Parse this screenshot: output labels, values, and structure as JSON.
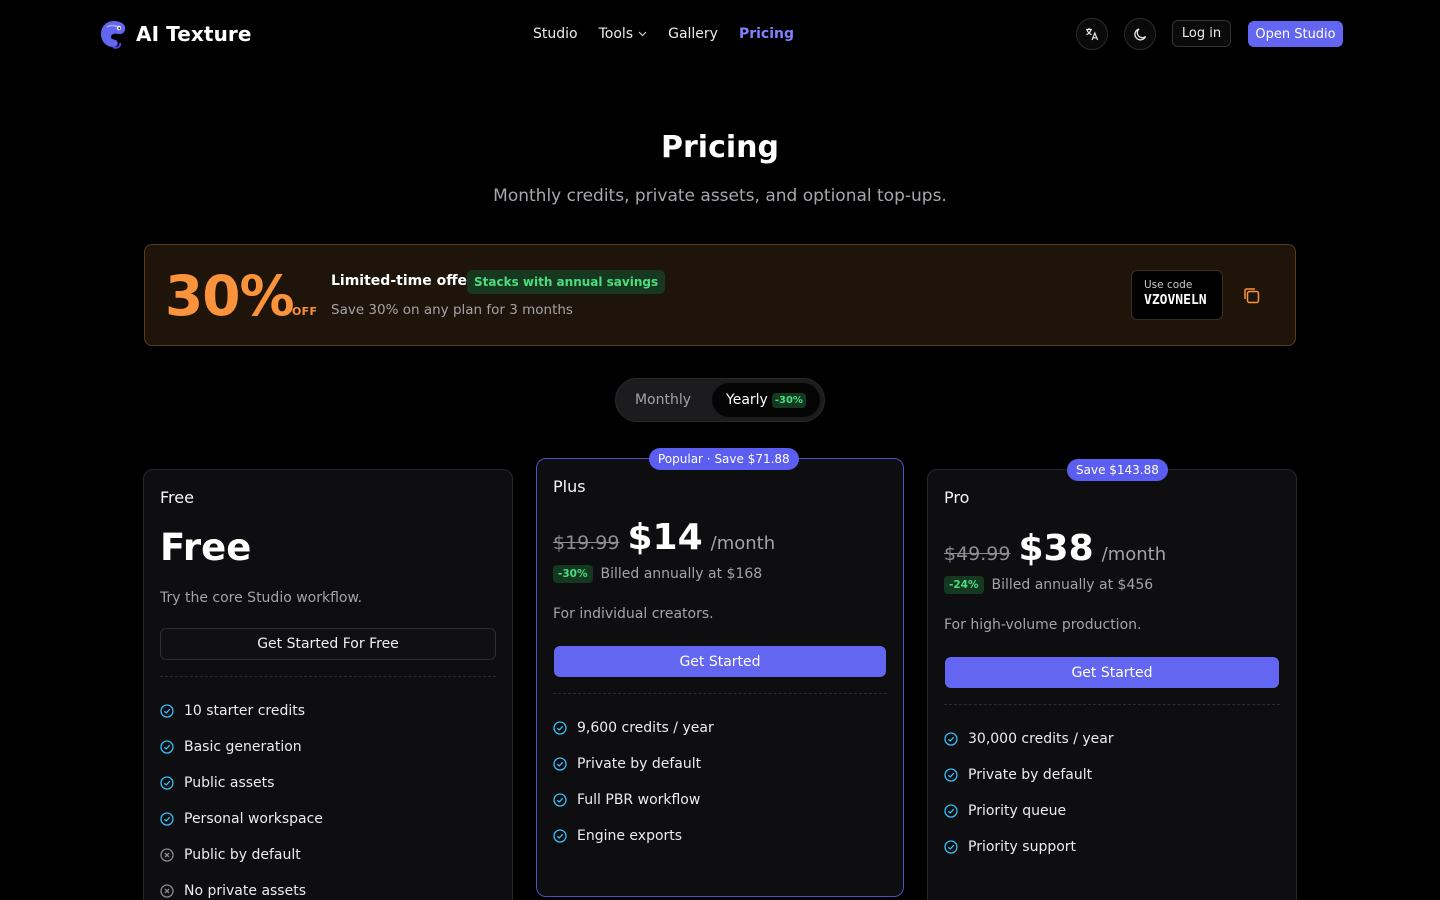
{
  "header": {
    "brand": "AI Texture",
    "nav": [
      {
        "label": "Studio"
      },
      {
        "label": "Tools"
      },
      {
        "label": "Gallery"
      },
      {
        "label": "Pricing"
      }
    ],
    "login_label": "Log in",
    "open_studio_label": "Open Studio"
  },
  "hero": {
    "title": "Pricing",
    "subtitle": "Monthly credits, private assets, and optional top-ups."
  },
  "offer": {
    "percent": "30%",
    "off": "OFF",
    "title": "Limited-time offer",
    "tag": "Stacks with annual savings",
    "description": "Save 30% on any plan for 3 months",
    "code_label": "Use code",
    "code": "VZOVNELN"
  },
  "billing": {
    "monthly": "Monthly",
    "yearly": "Yearly",
    "yearly_badge": "-30%",
    "selected": "Yearly"
  },
  "plans": {
    "free": {
      "name": "Free",
      "price": "Free",
      "description": "Try the core Studio workflow.",
      "button": "Get Started For Free",
      "features": [
        {
          "text": "10 starter credits",
          "included": true
        },
        {
          "text": "Basic generation",
          "included": true
        },
        {
          "text": "Public assets",
          "included": true
        },
        {
          "text": "Personal workspace",
          "included": true
        },
        {
          "text": "Public by default",
          "included": false
        },
        {
          "text": "No private assets",
          "included": false
        }
      ]
    },
    "plus": {
      "badge": "Popular · Save $71.88",
      "name": "Plus",
      "old_price": "$19.99",
      "price": "$14",
      "period": "/month",
      "discount": "-30%",
      "billed": "Billed annually at $168",
      "description": "For individual creators.",
      "button": "Get Started",
      "features": [
        {
          "text": "9,600 credits / year",
          "included": true
        },
        {
          "text": "Private by default",
          "included": true
        },
        {
          "text": "Full PBR workflow",
          "included": true
        },
        {
          "text": "Engine exports",
          "included": true
        }
      ]
    },
    "pro": {
      "badge": "Save $143.88",
      "name": "Pro",
      "old_price": "$49.99",
      "price": "$38",
      "period": "/month",
      "discount": "-24%",
      "billed": "Billed annually at $456",
      "description": "For high-volume production.",
      "button": "Get Started",
      "features": [
        {
          "text": "30,000 credits / year",
          "included": true
        },
        {
          "text": "Private by default",
          "included": true
        },
        {
          "text": "Priority queue",
          "included": true
        },
        {
          "text": "Priority support",
          "included": true
        }
      ]
    }
  },
  "colors": {
    "accent": "#6366f1",
    "accent_text": "#8181ff",
    "offer_orange": "#fb923c",
    "success_green": "#4ade80",
    "check_blue": "#38bdf8",
    "background": "#000000"
  }
}
